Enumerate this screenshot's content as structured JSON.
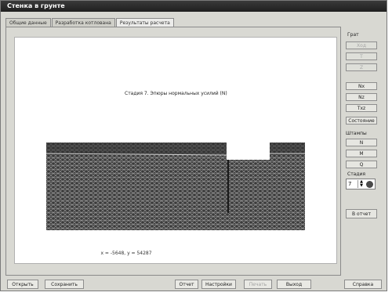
{
  "window": {
    "title": "Стенка в грунте"
  },
  "tabs": [
    {
      "label": "Общие данные"
    },
    {
      "label": "Разработка котлована"
    },
    {
      "label": "Результаты расчета"
    }
  ],
  "canvas": {
    "stage_title": "Стадия 7. Эпюры нормальных усилий (N)",
    "coords_text": "x = -5648, y = 54287"
  },
  "sidebar": {
    "grid_label": "Грат",
    "buttons_top": [
      "Ход",
      "Т",
      "Z",
      "Nx",
      "Nz",
      "Txz",
      "Состояние"
    ],
    "stamps_label": "Штампы",
    "buttons_stamps": [
      "N",
      "M",
      "Q"
    ],
    "stage_label": "Стадия",
    "stage_value": "7",
    "report_button": "В отчет"
  },
  "bottom": {
    "open": "Открыть",
    "save": "Сохранить",
    "report": "Отчет",
    "settings": "Настройки",
    "print": "Печать",
    "exit": "Выход",
    "help": "Справка"
  }
}
